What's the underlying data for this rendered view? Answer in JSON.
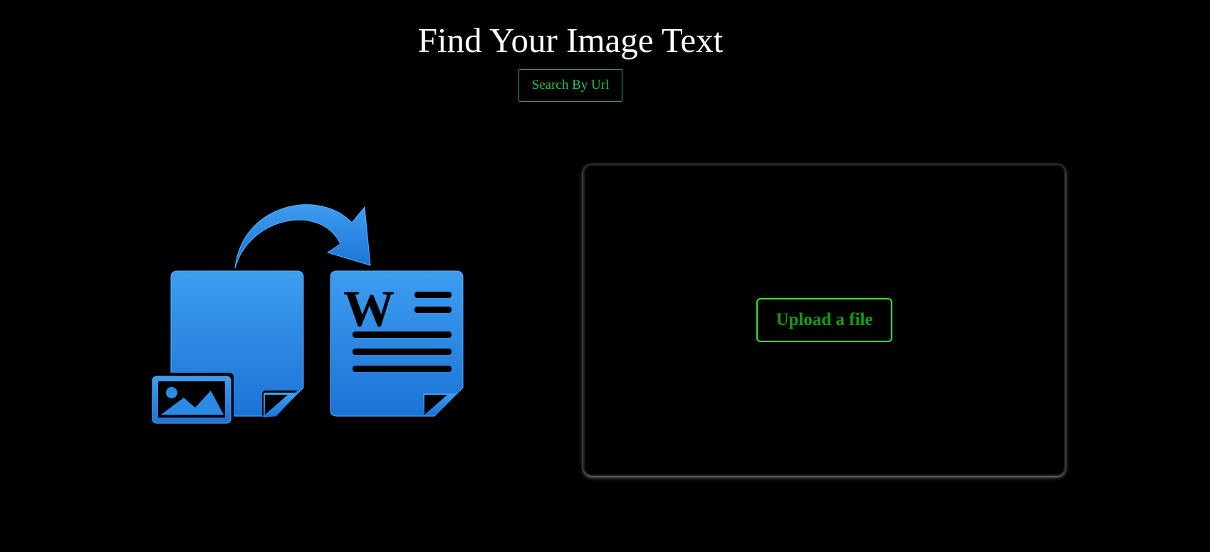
{
  "header": {
    "title": "Find Your Image Text",
    "search_by_url_label": "Search By Url"
  },
  "upload": {
    "button_label": "Upload a file"
  },
  "illustration": {
    "icon": "image-to-document-icon",
    "document_letter": "W",
    "color": "#2a8ae6"
  },
  "colors": {
    "background": "#000000",
    "title": "#ffffff",
    "accent_green": "#2fbf55",
    "upload_border": "#33e61a",
    "upload_text": "#149c14",
    "icon_blue": "#2a8ae6"
  }
}
